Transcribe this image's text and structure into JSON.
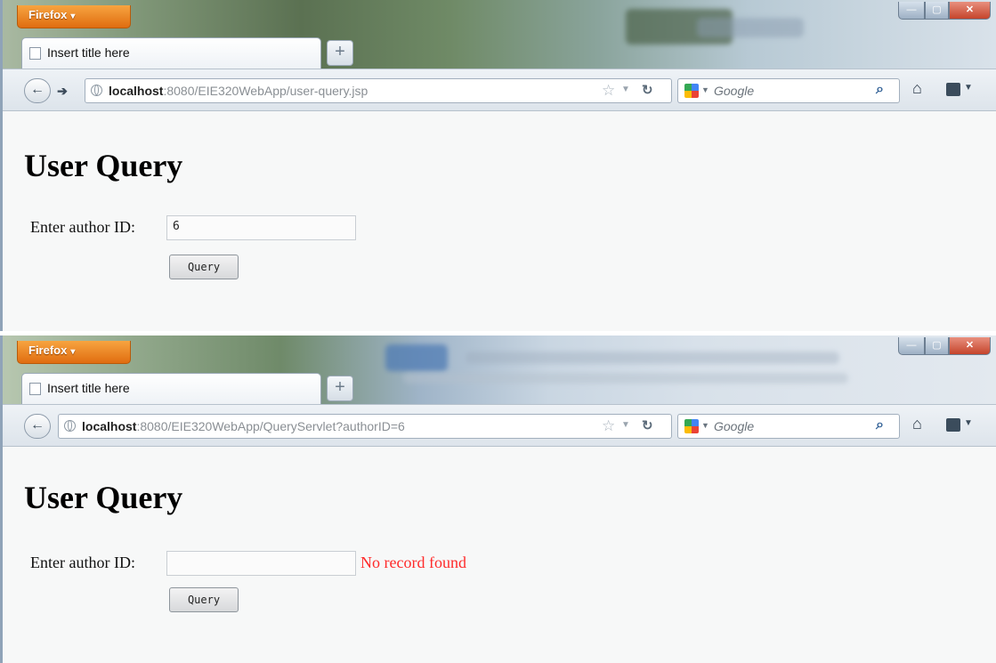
{
  "windows": [
    {
      "app_button": "Firefox",
      "tab_title": "Insert title here",
      "new_tab": "+",
      "url_host": "localhost",
      "url_rest": ":8080/EIE320WebApp/user-query.jsp",
      "search_placeholder": "Google",
      "page": {
        "title": "User Query",
        "field_label": "Enter author ID:",
        "field_value": "6",
        "button_label": "Query",
        "message": ""
      }
    },
    {
      "app_button": "Firefox",
      "tab_title": "Insert title here",
      "new_tab": "+",
      "url_host": "localhost",
      "url_rest": ":8080/EIE320WebApp/QueryServlet?authorID=6",
      "search_placeholder": "Google",
      "page": {
        "title": "User Query",
        "field_label": "Enter author ID:",
        "field_value": "",
        "button_label": "Query",
        "message": "No record found"
      }
    }
  ],
  "colors": {
    "error_text": "#ff2a2a",
    "firefox_button": "#e8801f"
  },
  "icons": [
    "back-icon",
    "forward-icon",
    "globe-icon",
    "star-icon",
    "reload-icon",
    "google-icon",
    "magnifier-icon",
    "home-icon",
    "addon-icon"
  ]
}
